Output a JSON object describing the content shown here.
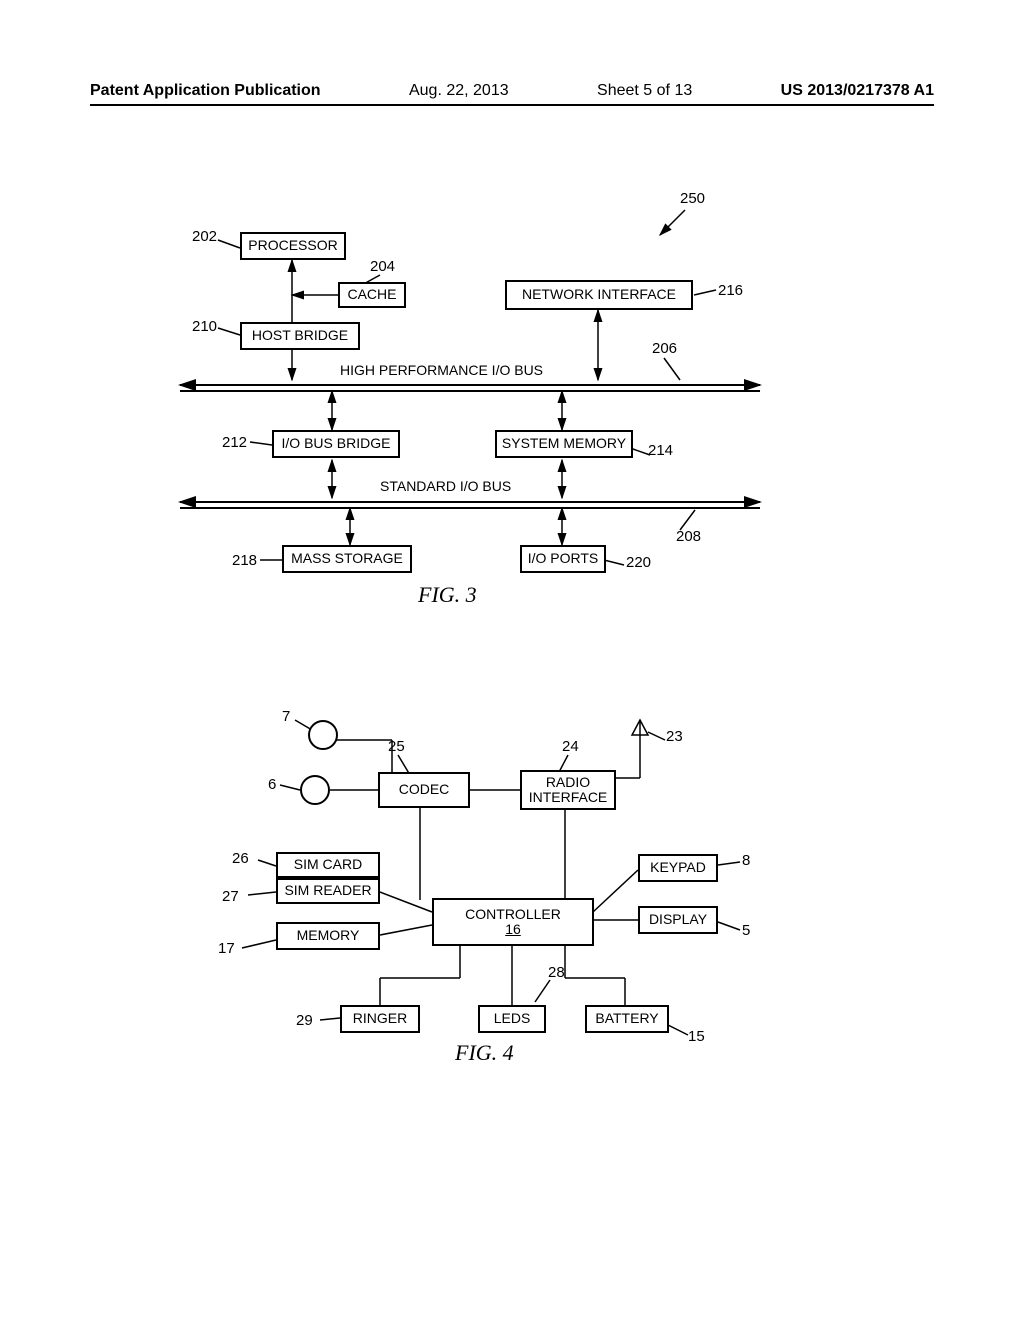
{
  "header": {
    "publication": "Patent Application Publication",
    "date": "Aug. 22, 2013",
    "sheet": "Sheet 5 of 13",
    "docnum": "US 2013/0217378 A1"
  },
  "fig3": {
    "caption": "FIG. 3",
    "ref_250": "250",
    "processor": {
      "label": "PROCESSOR",
      "ref": "202"
    },
    "cache": {
      "label": "CACHE",
      "ref": "204"
    },
    "network_if": {
      "label": "NETWORK INTERFACE",
      "ref": "216"
    },
    "host_bridge": {
      "label": "HOST BRIDGE",
      "ref": "210"
    },
    "hp_bus": {
      "label": "HIGH PERFORMANCE I/O BUS",
      "ref": "206"
    },
    "io_bus_bridge": {
      "label": "I/O BUS BRIDGE",
      "ref": "212"
    },
    "system_memory": {
      "label": "SYSTEM MEMORY",
      "ref": "214"
    },
    "std_bus": {
      "label": "STANDARD I/O BUS",
      "ref": "208"
    },
    "mass_storage": {
      "label": "MASS STORAGE",
      "ref": "218"
    },
    "io_ports": {
      "label": "I/O PORTS",
      "ref": "220"
    }
  },
  "fig4": {
    "caption": "FIG. 4",
    "ref_7": "7",
    "ref_6": "6",
    "ref_23": "23",
    "codec": {
      "label": "CODEC",
      "ref": "25"
    },
    "radio_if": {
      "label": "RADIO\nINTERFACE",
      "ref": "24"
    },
    "sim_card": {
      "label": "SIM CARD",
      "ref": "26"
    },
    "sim_reader": {
      "label": "SIM READER",
      "ref": "27"
    },
    "memory": {
      "label": "MEMORY",
      "ref": "17"
    },
    "controller": {
      "label": "CONTROLLER",
      "ref": "16"
    },
    "keypad": {
      "label": "KEYPAD",
      "ref": "8"
    },
    "display": {
      "label": "DISPLAY",
      "ref": "5"
    },
    "ringer": {
      "label": "RINGER",
      "ref": "29"
    },
    "leds": {
      "label": "LEDS",
      "ref": "28"
    },
    "battery": {
      "label": "BATTERY",
      "ref": "15"
    }
  }
}
